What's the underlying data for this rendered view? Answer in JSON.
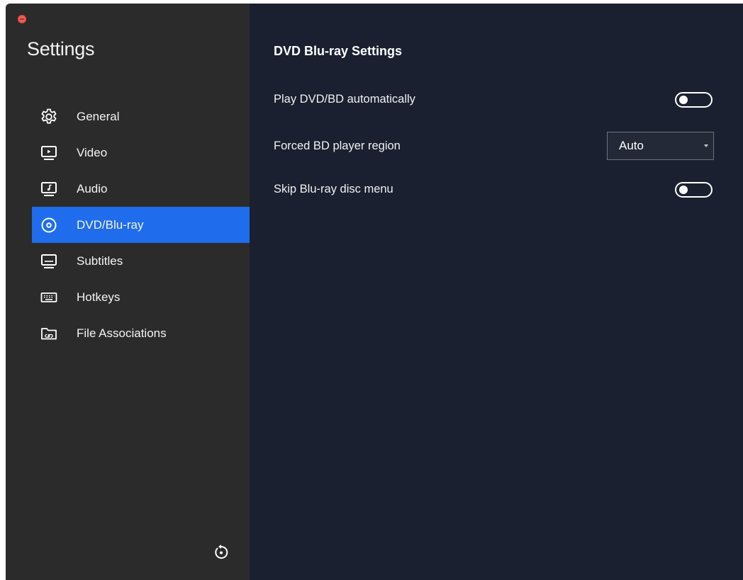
{
  "window": {
    "close_color": "#ee5e56"
  },
  "sidebar": {
    "title": "Settings",
    "active_color": "#1f6ded",
    "items": [
      {
        "label": "General",
        "icon": "gear-icon"
      },
      {
        "label": "Video",
        "icon": "video-icon"
      },
      {
        "label": "Audio",
        "icon": "audio-icon"
      },
      {
        "label": "DVD/Blu-ray",
        "icon": "disc-icon",
        "active": true
      },
      {
        "label": "Subtitles",
        "icon": "subtitles-icon"
      },
      {
        "label": "Hotkeys",
        "icon": "keyboard-icon"
      },
      {
        "label": "File Associations",
        "icon": "folder-link-icon"
      }
    ],
    "reset_icon": "reset-icon"
  },
  "main": {
    "title": "DVD Blu-ray Settings",
    "settings": [
      {
        "label": "Play DVD/BD automatically",
        "type": "toggle",
        "on": false
      },
      {
        "label": "Forced BD player region",
        "type": "select",
        "value": "Auto"
      },
      {
        "label": "Skip Blu-ray disc menu",
        "type": "toggle",
        "on": false
      }
    ]
  }
}
